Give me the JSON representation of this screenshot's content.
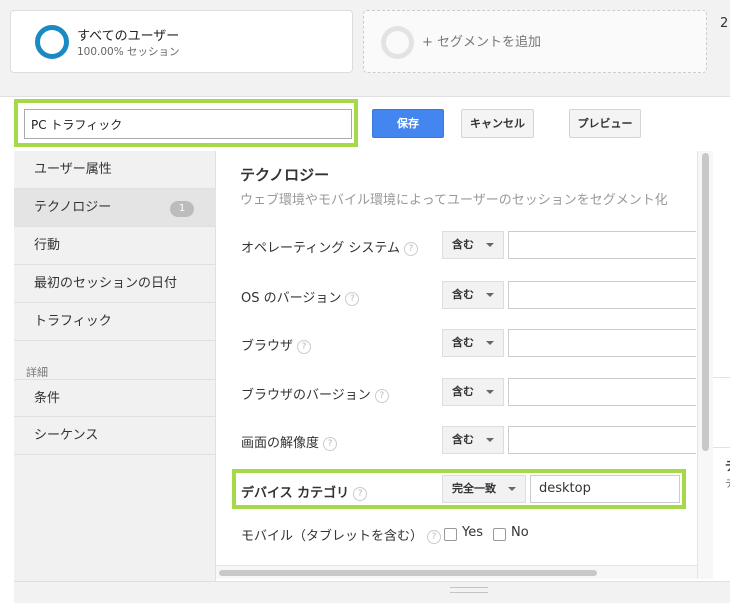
{
  "segments": {
    "active": {
      "name": "すべてのユーザー",
      "sub": "100.00% セッション"
    },
    "add_label": "+ セグメントを追加",
    "edge_number": "2"
  },
  "editor": {
    "segment_name": "PC トラフィック",
    "save_label": "保存",
    "cancel_label": "キャンセル",
    "preview_label": "プレビュー"
  },
  "nav": {
    "items": [
      {
        "label": "ユーザー属性"
      },
      {
        "label": "テクノロジー",
        "badge": "1"
      },
      {
        "label": "行動"
      },
      {
        "label": "最初のセッションの日付"
      },
      {
        "label": "トラフィック"
      }
    ],
    "advanced_heading": "詳細",
    "advanced_items": [
      {
        "label": "条件"
      },
      {
        "label": "シーケンス"
      }
    ]
  },
  "panel": {
    "title": "テクノロジー",
    "description": "ウェブ環境やモバイル環境によってユーザーのセッションをセグメント化",
    "help_glyph": "?",
    "rows": [
      {
        "label": "オペレーティング システム",
        "op": "含む",
        "value": ""
      },
      {
        "label": "OS のバージョン",
        "op": "含む",
        "value": ""
      },
      {
        "label": "ブラウザ",
        "op": "含む",
        "value": ""
      },
      {
        "label": "ブラウザのバージョン",
        "op": "含む",
        "value": ""
      },
      {
        "label": "画面の解像度",
        "op": "含む",
        "value": ""
      },
      {
        "label": "デバイス カテゴリ",
        "op": "完全一致",
        "value": "desktop"
      }
    ],
    "mobile": {
      "label": "モバイル（タブレットを含む）",
      "yes": "Yes",
      "no": "No"
    }
  },
  "right_edge": {
    "char1": "デ",
    "char2": "デ"
  },
  "colors": {
    "accent": "#4486ef",
    "ring": "#1c8ac2",
    "highlight": "#a6d94a"
  },
  "icons": [
    "donut-icon",
    "dropdown-caret-icon",
    "help-icon"
  ]
}
